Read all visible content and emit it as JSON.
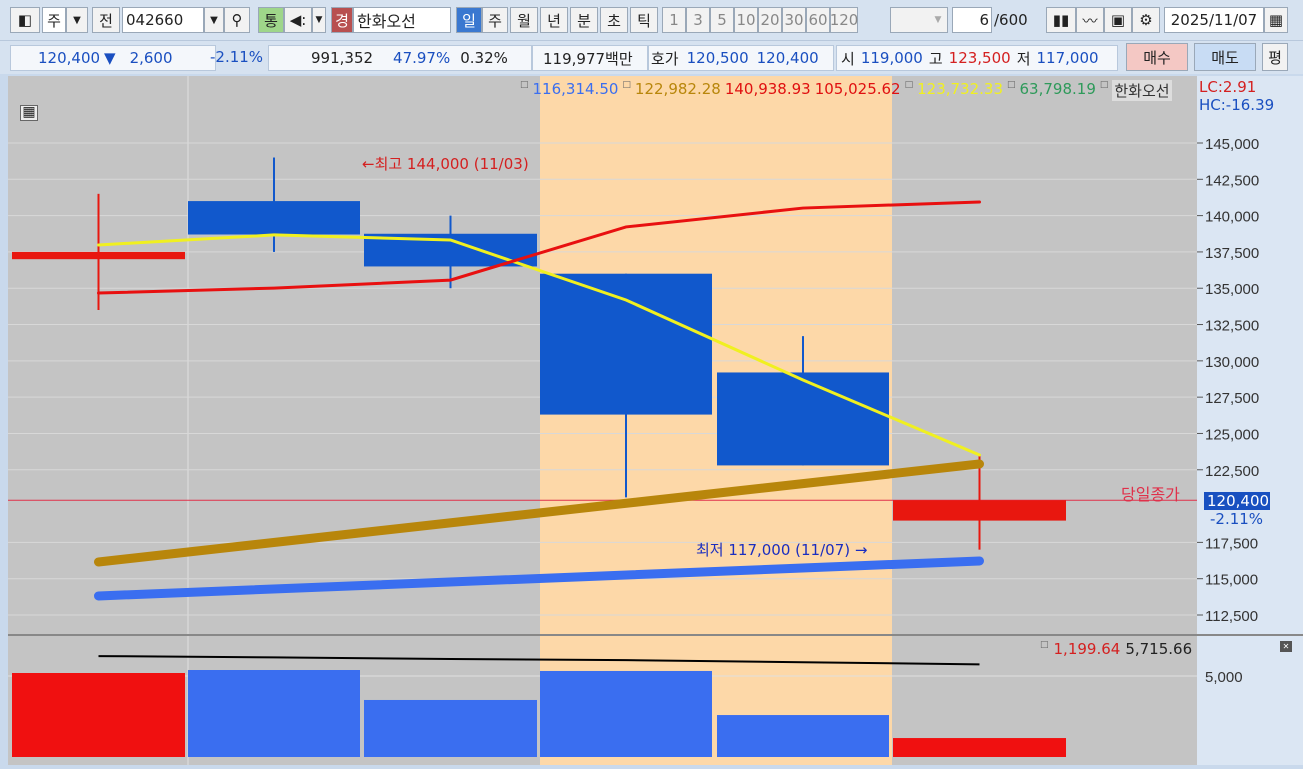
{
  "toolbar": {
    "market": "주",
    "prev": "전",
    "code": "042660",
    "tong": "통",
    "kyung": "경",
    "name": "한화오선",
    "periods": [
      "일",
      "주",
      "월",
      "년",
      "분",
      "초",
      "틱"
    ],
    "minutes": [
      "1",
      "3",
      "5",
      "10",
      "20",
      "30",
      "60",
      "120"
    ],
    "count": "6",
    "count_total": "/600",
    "date": "2025/11/07"
  },
  "quote": {
    "price": "120,400",
    "arrow": "▼",
    "change": "2,600",
    "change_pct": "-2.11%",
    "volume": "991,352",
    "ratio": "47.97%",
    "turnover": "0.32%",
    "amount": "119,977백만",
    "hoga_label": "호가",
    "ask": "120,500",
    "bid": "120,400",
    "open_label": "시",
    "open": "119,000",
    "high_label": "고",
    "high": "123,500",
    "low_label": "저",
    "low": "117,000",
    "buy": "매수",
    "sell": "매도",
    "avg": "평"
  },
  "legend": {
    "v1": "116,314.50",
    "v2": "122,982.28",
    "v3": "140,938.93",
    "v4": "105,025.62",
    "v5": "123,732.33",
    "v6": "63,798.19",
    "name": "한화오선",
    "lc": "LC:2.91",
    "hc": "HC:-16.39"
  },
  "annotations": {
    "high": "←최고 144,000 (11/03)",
    "low": "최저 117,000 (11/07) →",
    "close_label": "당일종가",
    "close_value": "120,400",
    "close_pct": "-2.11%"
  },
  "volume_legend": {
    "v1": "1,199.64",
    "v2": "5,715.66"
  },
  "colors": {
    "up": "#e8170f",
    "down": "#1158cc",
    "highlight": "#fdd8a8",
    "bg": "#c4c4c4"
  },
  "chart_data": {
    "type": "candlestick",
    "ylim": [
      111500,
      147500
    ],
    "yticks": [
      "145,000",
      "142,500",
      "140,000",
      "137,500",
      "135,000",
      "132,500",
      "130,000",
      "127,500",
      "125,000",
      "122,500",
      "117,500",
      "115,000",
      "112,500"
    ],
    "ytick_values": [
      145000,
      142500,
      140000,
      137500,
      135000,
      132500,
      130000,
      127500,
      125000,
      122500,
      117500,
      115000,
      112500
    ],
    "candles": [
      {
        "open": 137500,
        "close": 137000,
        "high": 141500,
        "low": 133500,
        "up": true
      },
      {
        "open": 141000,
        "close": 138700,
        "high": 144000,
        "low": 137500,
        "up": false
      },
      {
        "open": 138750,
        "close": 136500,
        "high": 140000,
        "low": 135000,
        "up": false
      },
      {
        "open": 136000,
        "close": 126300,
        "high": 136000,
        "low": 120600,
        "up": false
      },
      {
        "open": 129200,
        "close": 122800,
        "high": 131700,
        "low": 122800,
        "up": false
      },
      {
        "open": 119000,
        "close": 120400,
        "high": 123500,
        "low": 117000,
        "up": true
      }
    ],
    "lines": [
      {
        "name": "yellow",
        "color": "#f0f020",
        "width": 3,
        "values": [
          137980,
          138670,
          138320,
          134190,
          128680,
          123520
        ]
      },
      {
        "name": "red",
        "color": "#e81010",
        "width": 3,
        "values": [
          134670,
          135010,
          135560,
          139220,
          140520,
          140940
        ]
      },
      {
        "name": "gold",
        "color": "#b8860b",
        "width": 9,
        "values": [
          116150,
          null,
          null,
          null,
          null,
          122900
        ]
      },
      {
        "name": "blue",
        "color": "#3a6ef0",
        "width": 9,
        "values": [
          113810,
          null,
          null,
          null,
          null,
          116220
        ]
      }
    ],
    "current_price": 120400,
    "volume": {
      "ylim": [
        0,
        7300
      ],
      "ytick": "5,000",
      "ytick_value": 5000,
      "values": [
        5185,
        5370,
        3520,
        5310,
        2590,
        1170
      ],
      "up": [
        true,
        false,
        false,
        false,
        false,
        true
      ],
      "ma": [
        6230,
        6150,
        6050,
        5980,
        5850,
        5716
      ]
    }
  }
}
